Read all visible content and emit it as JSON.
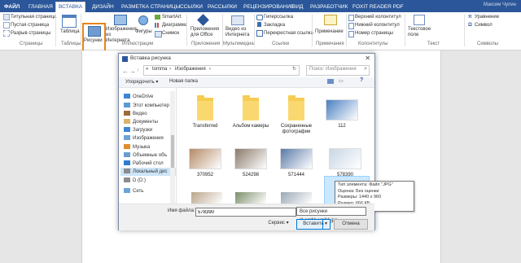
{
  "tabs": {
    "file": "ФАЙЛ",
    "home": "ГЛАВНАЯ",
    "insert": "ВСТАВКА",
    "design": "ДИЗАЙН",
    "layout": "РАЗМЕТКА СТРАНИЦЫ",
    "references": "ССЫЛКИ",
    "mailings": "РАССЫЛКИ",
    "review": "РЕЦЕНЗИРОВАНИЕ",
    "view": "ВИД",
    "developer": "РАЗРАБОТЧИК",
    "foxit": "FOXIT READER PDF",
    "user": "Максим Чупин"
  },
  "ribbon": {
    "pages": {
      "cover": "Титульная страница",
      "blank": "Пустая страница",
      "break": "Разрыв страницы",
      "group": "Страницы"
    },
    "tables": {
      "table": "Таблица",
      "group": "Таблицы"
    },
    "illustrations": {
      "pictures": "Рисунки",
      "online": "Изображения из Интернета",
      "shapes": "Фигуры",
      "smartart": "SmartArt",
      "chart": "Диаграмма",
      "screenshot": "Снимок",
      "group": "Иллюстрации"
    },
    "apps": {
      "office": "Приложения для Office",
      "group": "Приложения"
    },
    "media": {
      "video": "Видео из Интернета",
      "group": "Мультимедиа"
    },
    "links": {
      "hyperlink": "Гиперссылка",
      "bookmark": "Закладка",
      "cross": "Перекрестная ссылка",
      "group": "Ссылки"
    },
    "comments": {
      "comment": "Примечание",
      "group": "Примечания"
    },
    "header": {
      "top": "Верхний колонтитул",
      "bottom": "Нижний колонтитул",
      "number": "Номер страницы",
      "group": "Колонтитулы"
    },
    "text": {
      "textbox": "Текстовое поле",
      "group": "Текст"
    },
    "symbols": {
      "equation": "Уравнение",
      "symbol": "Символ",
      "group": "Символы"
    }
  },
  "dialog": {
    "title": "Вставка рисунка",
    "path": [
      "«",
      "tomma",
      "›",
      "Изображения",
      "›"
    ],
    "search_placeholder": "Поиск: Изображения",
    "organize": "Упорядочить ▾",
    "new_folder": "Новая папка",
    "nav": [
      "OneDrive",
      "Этот компьютер",
      "Видео",
      "Документы",
      "Загрузки",
      "Изображения",
      "Музыка",
      "Объемные объ",
      "Рабочий стол",
      "Локальный дис",
      "D (D:)",
      "Сеть"
    ],
    "items": [
      {
        "name": "Transferred",
        "kind": "folder"
      },
      {
        "name": "Альбом камеры",
        "kind": "folder"
      },
      {
        "name": "Сохраненные фотографии",
        "kind": "folder"
      },
      {
        "name": "112",
        "kind": "image",
        "color": "#4a7fc1"
      },
      {
        "name": "370952",
        "kind": "image",
        "color": "#b58a67"
      },
      {
        "name": "524298",
        "kind": "image",
        "color": "#8a7a6a"
      },
      {
        "name": "571444",
        "kind": "image",
        "color": "#5a7aa8"
      },
      {
        "name": "578390",
        "kind": "image",
        "color": "#c8d6e4"
      }
    ],
    "tooltip": [
      "Тип элемента: Файл \"JPG\"",
      "Оценка: Без оценки",
      "Размеры: 1440 x 960",
      "Размер: 666 КБ"
    ],
    "filename_label": "Имя файла:",
    "filename_value": "578390",
    "filetype": "Все рисунки (*.emf;*.wmf;*.jpg",
    "service": "Сервис",
    "insert": "Вставить",
    "cancel": "Отмена"
  }
}
